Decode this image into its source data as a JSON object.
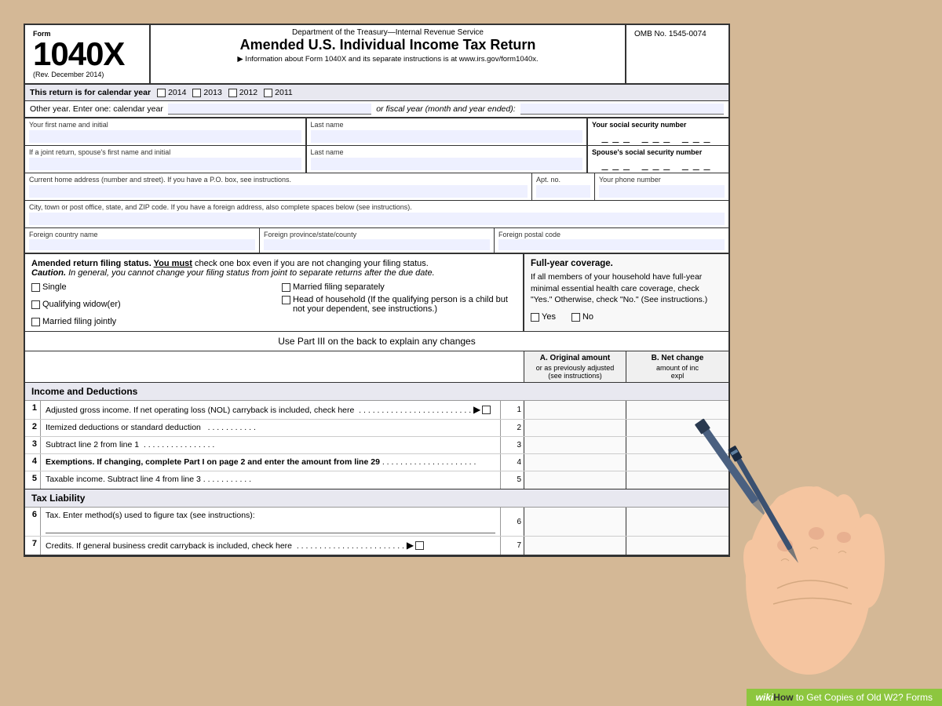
{
  "page": {
    "background_color": "#d4b896"
  },
  "form": {
    "number": "1040X",
    "form_label": "Form",
    "rev_note": "(Rev. December 2014)",
    "dept_line": "Department of the Treasury—Internal Revenue Service",
    "title": "Amended U.S. Individual Income Tax Return",
    "instructions": "▶ Information about Form 1040X and its separate instructions is at www.irs.gov/form1040x.",
    "omb": "OMB No. 1545-0074",
    "year_label": "This return is for calendar year",
    "years": [
      "2014",
      "2013",
      "2012",
      "2011"
    ],
    "other_year": "Other year. Enter one: calendar year",
    "or_text": "or fiscal year (month and year ended):",
    "fields": {
      "first_name_label": "Your first name and initial",
      "last_name_label": "Last name",
      "ssn_label": "Your social security number",
      "ssn_dashes": "— —",
      "spouse_first_label": "If a joint return, spouse's first name and initial",
      "spouse_last_label": "Last name",
      "spouse_ssn_label": "Spouse's social security number",
      "spouse_ssn_dashes": "— —",
      "address_label": "Current home address (number and street). If you have a P.O. box, see instructions.",
      "apt_label": "Apt. no.",
      "phone_label": "Your phone number",
      "city_label": "City, town or post office, state, and ZIP code.  If you have a foreign address, also complete spaces below (see instructions).",
      "foreign_country_label": "Foreign country name",
      "foreign_province_label": "Foreign province/state/county",
      "foreign_postal_label": "Foreign postal code"
    },
    "filing_status": {
      "title_start": "Amended return filing status.",
      "title_bold": " You must",
      "title_end": " check one box even if you are not changing your filing status.",
      "caution": "Caution.",
      "caution_text": " In general, you cannot change your filing status from joint to separate returns after the due date.",
      "options": [
        "Single",
        "Married filing separately",
        "Qualifying widow(er)",
        "Head of household (If the qualifying person is a child but not your dependent, see instructions.)",
        "Married filing jointly"
      ]
    },
    "full_year": {
      "title": "Full-year coverage.",
      "text": "If all members of your household have full-year minimal essential health care coverage, check \"Yes.\" Otherwise, check \"No.\" (See instructions.)",
      "yes_label": "Yes",
      "no_label": "No"
    },
    "part3_text": "Use Part III on the back to explain any changes",
    "columns": {
      "a_header": "A. Original amount",
      "a_sub": "or as previously adjusted",
      "a_sub2": "(see instructions)",
      "b_header": "B. Net change",
      "b_sub": "amount of inc",
      "b_sub2": "expl"
    },
    "income_section": {
      "header": "Income and Deductions",
      "lines": [
        {
          "num": "1",
          "desc": "Adjusted gross income. If net operating loss (NOL) carryback is included, check here  .  .  .  .  .  .  .  .  .  .  .  .  .  .  .  .  .  .  .  .  .  .  .  .  .",
          "has_arrow_cb": true,
          "ref": "1"
        },
        {
          "num": "2",
          "desc": "Itemized deductions or standard deduction   .  .  .  .  .  .  .  .  .  .  .",
          "ref": "2"
        },
        {
          "num": "3",
          "desc": "Subtract line 2 from line 1  .  .  .  .  .  .  .  .  .  .  .  .  .  .  .  .",
          "ref": "3"
        },
        {
          "num": "4",
          "desc": "Exemptions. If changing, complete Part I on page 2 and enter the amount from line 29  .  .  .  .  .  .  .  .  .  .  .  .  .  .  .  .  .  .  .  .  .  .",
          "ref": "4",
          "bold_start": "Exemptions."
        },
        {
          "num": "5",
          "desc": "Taxable income. Subtract line 4 from line 3 .  .  .  .  .  .  .  .  .  .  .",
          "ref": "5"
        }
      ]
    },
    "tax_section": {
      "header": "Tax Liability",
      "lines": [
        {
          "num": "6",
          "desc": "Tax. Enter method(s) used to figure tax (see instructions):",
          "ref": "6",
          "has_line": true
        },
        {
          "num": "7",
          "desc": "Credits. If general business credit carryback is included, check here  .  .  .  .  .  .  .  .  .  .  .  .  .  .  .  .  .  .  .  .  .  .  .  .  .",
          "has_arrow_cb": true,
          "ref": "7"
        }
      ]
    }
  },
  "wikihow": {
    "wiki_text": "wiki",
    "how_text": "How",
    "suffix": " to Get Copies of Old W2? Forms"
  }
}
